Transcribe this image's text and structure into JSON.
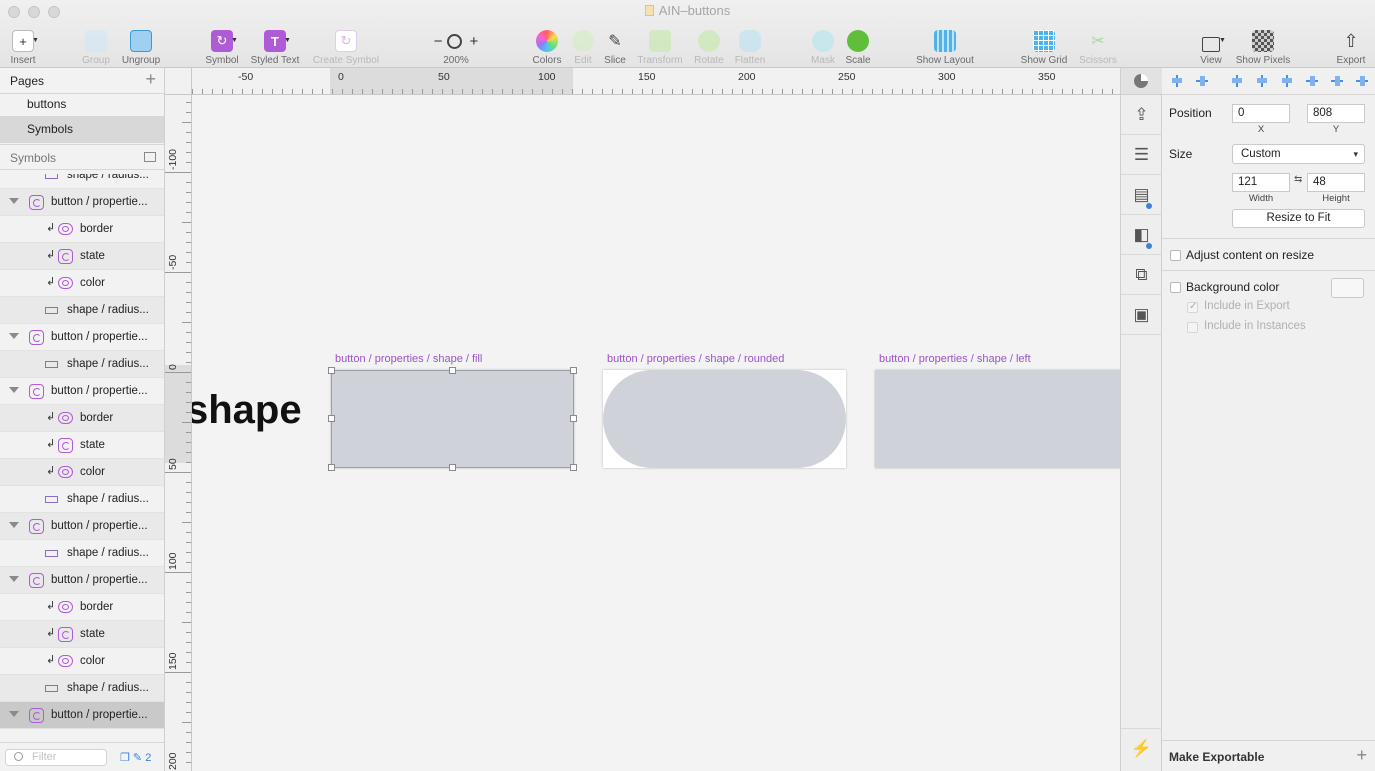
{
  "window": {
    "title": "AIN–buttons"
  },
  "toolbar": {
    "insert": "Insert",
    "group": "Group",
    "ungroup": "Ungroup",
    "symbol": "Symbol",
    "styled_text": "Styled Text",
    "create_symbol": "Create Symbol",
    "zoom_level": "200%",
    "zoom_minus": "−",
    "zoom_plus": "+",
    "colors": "Colors",
    "edit": "Edit",
    "slice": "Slice",
    "transform": "Transform",
    "rotate": "Rotate",
    "flatten": "Flatten",
    "mask": "Mask",
    "scale": "Scale",
    "show_layout": "Show Layout",
    "show_grid": "Show Grid",
    "scissors": "Scissors",
    "view": "View",
    "show_pixels": "Show Pixels",
    "export": "Export"
  },
  "sidebar": {
    "pages_title": "Pages",
    "pages": [
      {
        "label": "buttons"
      },
      {
        "label": "Symbols"
      }
    ],
    "symbols_title": "Symbols",
    "layers": [
      {
        "label": "shape / radius...",
        "kind": "rect",
        "depth": 1
      },
      {
        "label": "button / propertie...",
        "kind": "symbol",
        "depth": 0
      },
      {
        "label": "border",
        "kind": "override",
        "depth": 2
      },
      {
        "label": "state",
        "kind": "symbolov",
        "depth": 2
      },
      {
        "label": "color",
        "kind": "override",
        "depth": 2
      },
      {
        "label": "shape / radius...",
        "kind": "rect",
        "depth": 1
      },
      {
        "label": "button / propertie...",
        "kind": "symbol",
        "depth": 0
      },
      {
        "label": "shape / radius...",
        "kind": "rect",
        "depth": 1
      },
      {
        "label": "button / propertie...",
        "kind": "symbol",
        "depth": 0
      },
      {
        "label": "border",
        "kind": "override",
        "depth": 2
      },
      {
        "label": "state",
        "kind": "symbolov",
        "depth": 2
      },
      {
        "label": "color",
        "kind": "override",
        "depth": 2
      },
      {
        "label": "shape / radius...",
        "kind": "rect",
        "depth": 1
      },
      {
        "label": "button / propertie...",
        "kind": "symbol",
        "depth": 0
      },
      {
        "label": "shape / radius...",
        "kind": "rect",
        "depth": 1
      },
      {
        "label": "button / propertie...",
        "kind": "symbol",
        "depth": 0
      },
      {
        "label": "border",
        "kind": "override",
        "depth": 2
      },
      {
        "label": "state",
        "kind": "symbolov",
        "depth": 2
      },
      {
        "label": "color",
        "kind": "override",
        "depth": 2
      },
      {
        "label": "shape / radius...",
        "kind": "rect",
        "depth": 1
      },
      {
        "label": "button / propertie...",
        "kind": "symbol",
        "depth": 0
      }
    ],
    "filter_placeholder": "Filter",
    "footer_count": "2"
  },
  "rulers": {
    "top": [
      "-50",
      "0",
      "50",
      "100",
      "150",
      "200",
      "250",
      "300",
      "350"
    ],
    "left": [
      "-100",
      "-50",
      "0",
      "50",
      "100",
      "150",
      "200"
    ]
  },
  "canvas": {
    "big_text": "shape",
    "artboards": [
      {
        "title": "button / properties / shape / fill",
        "shape": "fill"
      },
      {
        "title": "button / properties / shape / rounded",
        "shape": "rounded"
      },
      {
        "title": "button / properties / shape / left",
        "shape": "left"
      }
    ]
  },
  "inspector": {
    "position_label": "Position",
    "x_value": "0",
    "y_value": "808",
    "x_label": "X",
    "y_label": "Y",
    "size_label": "Size",
    "size_preset": "Custom",
    "width_value": "121",
    "height_value": "48",
    "width_label": "Width",
    "height_label": "Height",
    "resize_to_fit": "Resize to Fit",
    "adjust_content": "Adjust content on resize",
    "background_color": "Background color",
    "include_in_export": "Include in Export",
    "include_in_instances": "Include in Instances",
    "make_exportable": "Make Exportable"
  },
  "colors": {
    "symbol_purple": "#b05bd6",
    "shape_fill": "#cfd2d8",
    "artboard_title": "#9a55c6",
    "accent_blue": "#3b82d8"
  }
}
